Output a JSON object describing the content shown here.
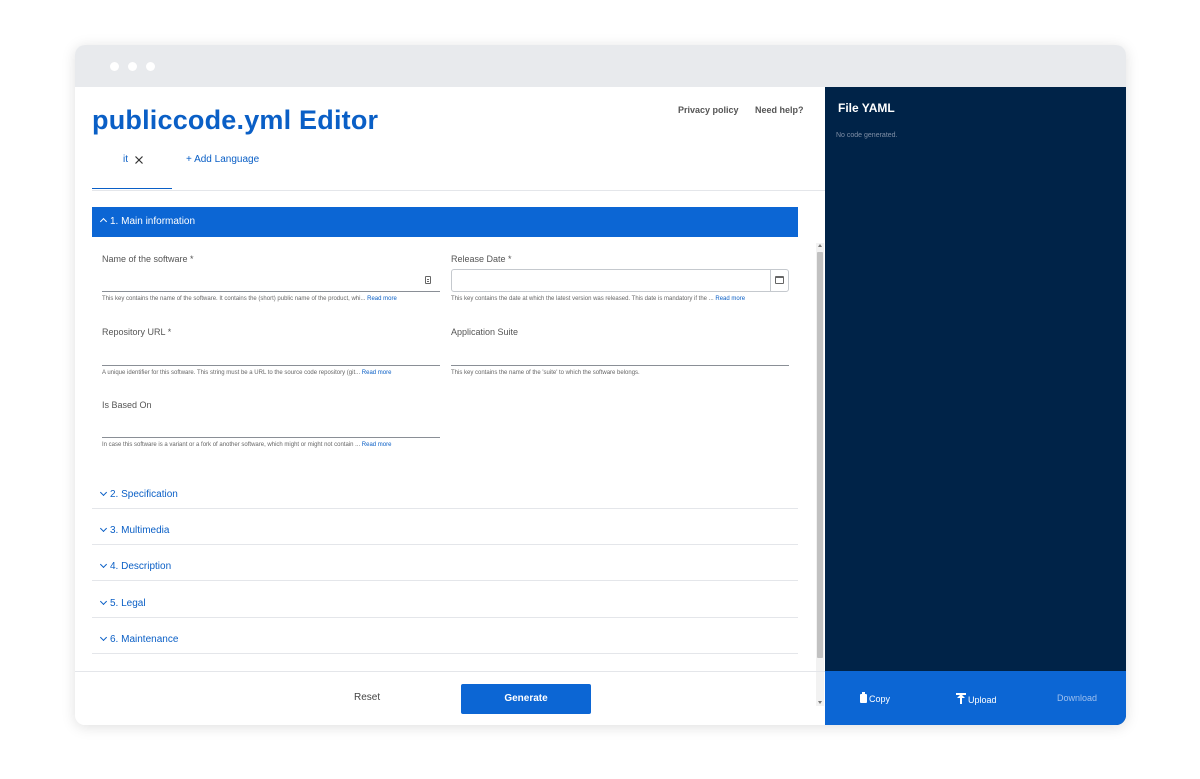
{
  "header": {
    "title": "publiccode.yml Editor",
    "privacy_link": "Privacy policy",
    "help_link": "Need help?"
  },
  "languages": {
    "active": "it",
    "add_label": "+ Add Language"
  },
  "sections": {
    "main": {
      "label": "1. Main information",
      "expanded": true
    },
    "collapsed": [
      {
        "label": "2. Specification"
      },
      {
        "label": "3. Multimedia"
      },
      {
        "label": "4. Description"
      },
      {
        "label": "5. Legal"
      },
      {
        "label": "6. Maintenance"
      }
    ]
  },
  "fields": {
    "name": {
      "label": "Name of the software *",
      "value": "",
      "help": "This key contains the name of the software. It contains the (short) public name of the product, whi...",
      "read_more": "Read more"
    },
    "release_date": {
      "label": "Release Date *",
      "value": "",
      "help": "This key contains the date at which the latest version was released. This date is mandatory if the ...",
      "read_more": "Read more"
    },
    "repo_url": {
      "label": "Repository URL *",
      "value": "",
      "help": "A unique identifier for this software. This string must be a URL to the source code repository (git...",
      "read_more": "Read more"
    },
    "app_suite": {
      "label": "Application Suite",
      "value": "",
      "help": "This key contains the name of the 'suite' to which the software belongs."
    },
    "is_based_on": {
      "label": "Is Based On",
      "value": "",
      "help": "In case this software is a variant or a fork of another software, which might or might not contain ...",
      "read_more": "Read more"
    }
  },
  "footer": {
    "reset_label": "Reset",
    "generate_label": "Generate"
  },
  "yaml_panel": {
    "title": "File YAML",
    "empty_message": "No code generated.",
    "copy_label": "Copy",
    "upload_label": "Upload",
    "download_label": "Download"
  },
  "colors": {
    "primary": "#0c66d4",
    "link": "#0a5fc6",
    "panel_bg": "#002348",
    "window_chrome": "#e8eaed"
  }
}
